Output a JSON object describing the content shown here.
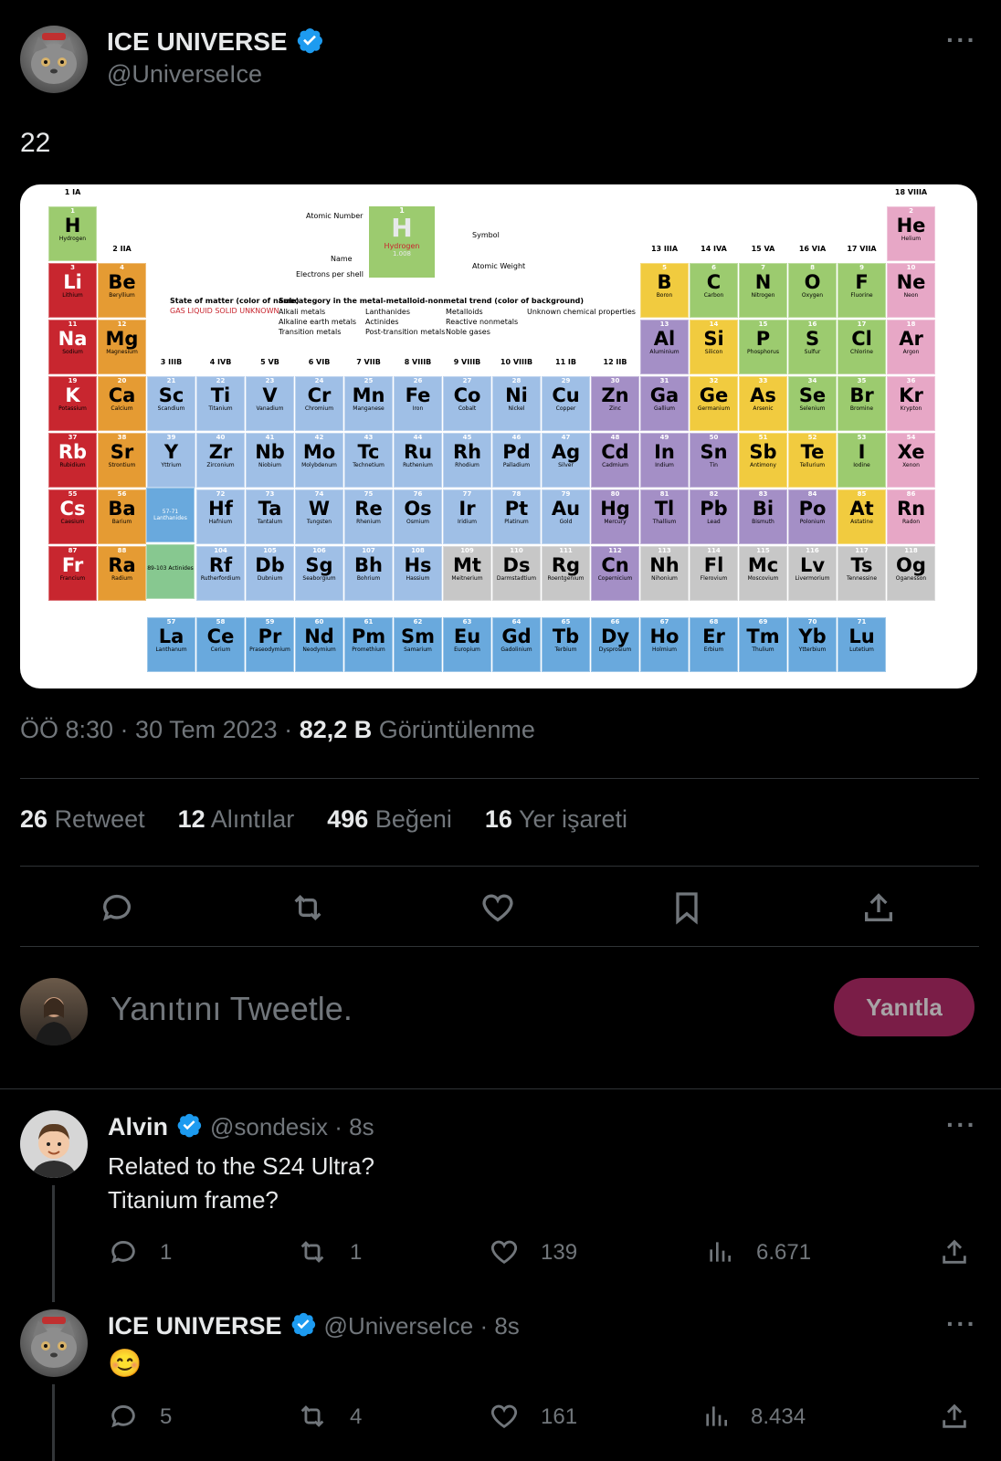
{
  "tweet": {
    "author_name": "ICE UNIVERSE",
    "author_handle": "@UniverseIce",
    "text": "22",
    "timestamp": "ÖÖ 8:30 · 30 Tem 2023 ·",
    "views_count": "82,2 B",
    "views_label": "Görüntülenme",
    "stats": [
      {
        "count": "26",
        "label": "Retweet"
      },
      {
        "count": "12",
        "label": "Alıntılar"
      },
      {
        "count": "496",
        "label": "Beğeni"
      },
      {
        "count": "16",
        "label": "Yer işareti"
      }
    ]
  },
  "image": {
    "legend_atomic_number": "Atomic Number",
    "legend_symbol": "Symbol",
    "legend_name": "Name",
    "legend_weight": "Atomic Weight",
    "legend_shells": "Electrons per shell",
    "legend_state": "State of matter (color of name)",
    "legend_state_values": "GAS  LIQUID  SOLID  UNKNOWN",
    "legend_subcat": "Subcategory in the metal-metalloid-nonmetal trend (color of background)",
    "legend_items": [
      "Alkali metals",
      "Alkaline earth metals",
      "Transition metals",
      "Lanthanides",
      "Actinides",
      "Post-transition metals",
      "Metalloids",
      "Reactive nonmetals",
      "Noble gases",
      "Unknown chemical properties"
    ],
    "key_number": "1",
    "key_symbol": "H",
    "key_name": "Hydrogen",
    "key_weight": "1.008",
    "lanthanides_label": "57-71 Lanthanides",
    "actinides_label": "89-103 Actinides",
    "groups": [
      "1 IA",
      "2 IIA",
      "3 IIIB",
      "4 IVB",
      "5 VB",
      "6 VIB",
      "7 VIIB",
      "8 VIIIB",
      "9 VIIIB",
      "10 VIIIB",
      "11 IB",
      "12 IIB",
      "13 IIIA",
      "14 IVA",
      "15 VA",
      "16 VIA",
      "17 VIIA",
      "18 VIIIA"
    ],
    "colors": {
      "alkali": "#c8262f",
      "alkaline": "#e59b33",
      "transition": "#9fbfe6",
      "post": "#a48fc6",
      "metalloid": "#f1cb3f",
      "nonmetal": "#9ccb6f",
      "noble": "#e7a7c6",
      "unknown": "#c7c7c7",
      "lanth": "#69a9dd",
      "actin": "#87c890"
    },
    "elements": [
      {
        "num": "1",
        "sym": "H",
        "name": "Hydrogen",
        "cat": "nonmetal"
      },
      {
        "num": "2",
        "sym": "He",
        "name": "Helium",
        "cat": "noble"
      },
      {
        "num": "3",
        "sym": "Li",
        "name": "Lithium",
        "cat": "alkali"
      },
      {
        "num": "4",
        "sym": "Be",
        "name": "Beryllium",
        "cat": "alkaline"
      },
      {
        "num": "5",
        "sym": "B",
        "name": "Boron",
        "cat": "metalloid"
      },
      {
        "num": "6",
        "sym": "C",
        "name": "Carbon",
        "cat": "nonmetal"
      },
      {
        "num": "7",
        "sym": "N",
        "name": "Nitrogen",
        "cat": "nonmetal"
      },
      {
        "num": "8",
        "sym": "O",
        "name": "Oxygen",
        "cat": "nonmetal"
      },
      {
        "num": "9",
        "sym": "F",
        "name": "Fluorine",
        "cat": "nonmetal"
      },
      {
        "num": "10",
        "sym": "Ne",
        "name": "Neon",
        "cat": "noble"
      },
      {
        "num": "11",
        "sym": "Na",
        "name": "Sodium",
        "cat": "alkali"
      },
      {
        "num": "12",
        "sym": "Mg",
        "name": "Magnesium",
        "cat": "alkaline"
      },
      {
        "num": "13",
        "sym": "Al",
        "name": "Aluminium",
        "cat": "post"
      },
      {
        "num": "14",
        "sym": "Si",
        "name": "Silicon",
        "cat": "metalloid"
      },
      {
        "num": "15",
        "sym": "P",
        "name": "Phosphorus",
        "cat": "nonmetal"
      },
      {
        "num": "16",
        "sym": "S",
        "name": "Sulfur",
        "cat": "nonmetal"
      },
      {
        "num": "17",
        "sym": "Cl",
        "name": "Chlorine",
        "cat": "nonmetal"
      },
      {
        "num": "18",
        "sym": "Ar",
        "name": "Argon",
        "cat": "noble"
      },
      {
        "num": "19",
        "sym": "K",
        "name": "Potassium",
        "cat": "alkali"
      },
      {
        "num": "20",
        "sym": "Ca",
        "name": "Calcium",
        "cat": "alkaline"
      },
      {
        "num": "21",
        "sym": "Sc",
        "name": "Scandium",
        "cat": "transition"
      },
      {
        "num": "22",
        "sym": "Ti",
        "name": "Titanium",
        "cat": "transition"
      },
      {
        "num": "23",
        "sym": "V",
        "name": "Vanadium",
        "cat": "transition"
      },
      {
        "num": "24",
        "sym": "Cr",
        "name": "Chromium",
        "cat": "transition"
      },
      {
        "num": "25",
        "sym": "Mn",
        "name": "Manganese",
        "cat": "transition"
      },
      {
        "num": "26",
        "sym": "Fe",
        "name": "Iron",
        "cat": "transition"
      },
      {
        "num": "27",
        "sym": "Co",
        "name": "Cobalt",
        "cat": "transition"
      },
      {
        "num": "28",
        "sym": "Ni",
        "name": "Nickel",
        "cat": "transition"
      },
      {
        "num": "29",
        "sym": "Cu",
        "name": "Copper",
        "cat": "transition"
      },
      {
        "num": "30",
        "sym": "Zn",
        "name": "Zinc",
        "cat": "post"
      },
      {
        "num": "31",
        "sym": "Ga",
        "name": "Gallium",
        "cat": "post"
      },
      {
        "num": "32",
        "sym": "Ge",
        "name": "Germanium",
        "cat": "metalloid"
      },
      {
        "num": "33",
        "sym": "As",
        "name": "Arsenic",
        "cat": "metalloid"
      },
      {
        "num": "34",
        "sym": "Se",
        "name": "Selenium",
        "cat": "nonmetal"
      },
      {
        "num": "35",
        "sym": "Br",
        "name": "Bromine",
        "cat": "nonmetal"
      },
      {
        "num": "36",
        "sym": "Kr",
        "name": "Krypton",
        "cat": "noble"
      },
      {
        "num": "37",
        "sym": "Rb",
        "name": "Rubidium",
        "cat": "alkali"
      },
      {
        "num": "38",
        "sym": "Sr",
        "name": "Strontium",
        "cat": "alkaline"
      },
      {
        "num": "39",
        "sym": "Y",
        "name": "Yttrium",
        "cat": "transition"
      },
      {
        "num": "40",
        "sym": "Zr",
        "name": "Zirconium",
        "cat": "transition"
      },
      {
        "num": "41",
        "sym": "Nb",
        "name": "Niobium",
        "cat": "transition"
      },
      {
        "num": "42",
        "sym": "Mo",
        "name": "Molybdenum",
        "cat": "transition"
      },
      {
        "num": "43",
        "sym": "Tc",
        "name": "Technetium",
        "cat": "transition"
      },
      {
        "num": "44",
        "sym": "Ru",
        "name": "Ruthenium",
        "cat": "transition"
      },
      {
        "num": "45",
        "sym": "Rh",
        "name": "Rhodium",
        "cat": "transition"
      },
      {
        "num": "46",
        "sym": "Pd",
        "name": "Palladium",
        "cat": "transition"
      },
      {
        "num": "47",
        "sym": "Ag",
        "name": "Silver",
        "cat": "transition"
      },
      {
        "num": "48",
        "sym": "Cd",
        "name": "Cadmium",
        "cat": "post"
      },
      {
        "num": "49",
        "sym": "In",
        "name": "Indium",
        "cat": "post"
      },
      {
        "num": "50",
        "sym": "Sn",
        "name": "Tin",
        "cat": "post"
      },
      {
        "num": "51",
        "sym": "Sb",
        "name": "Antimony",
        "cat": "metalloid"
      },
      {
        "num": "52",
        "sym": "Te",
        "name": "Tellurium",
        "cat": "metalloid"
      },
      {
        "num": "53",
        "sym": "I",
        "name": "Iodine",
        "cat": "nonmetal"
      },
      {
        "num": "54",
        "sym": "Xe",
        "name": "Xenon",
        "cat": "noble"
      },
      {
        "num": "55",
        "sym": "Cs",
        "name": "Caesium",
        "cat": "alkali"
      },
      {
        "num": "56",
        "sym": "Ba",
        "name": "Barium",
        "cat": "alkaline"
      },
      {
        "num": "72",
        "sym": "Hf",
        "name": "Hafnium",
        "cat": "transition"
      },
      {
        "num": "73",
        "sym": "Ta",
        "name": "Tantalum",
        "cat": "transition"
      },
      {
        "num": "74",
        "sym": "W",
        "name": "Tungsten",
        "cat": "transition"
      },
      {
        "num": "75",
        "sym": "Re",
        "name": "Rhenium",
        "cat": "transition"
      },
      {
        "num": "76",
        "sym": "Os",
        "name": "Osmium",
        "cat": "transition"
      },
      {
        "num": "77",
        "sym": "Ir",
        "name": "Iridium",
        "cat": "transition"
      },
      {
        "num": "78",
        "sym": "Pt",
        "name": "Platinum",
        "cat": "transition"
      },
      {
        "num": "79",
        "sym": "Au",
        "name": "Gold",
        "cat": "transition"
      },
      {
        "num": "80",
        "sym": "Hg",
        "name": "Mercury",
        "cat": "post"
      },
      {
        "num": "81",
        "sym": "Tl",
        "name": "Thallium",
        "cat": "post"
      },
      {
        "num": "82",
        "sym": "Pb",
        "name": "Lead",
        "cat": "post"
      },
      {
        "num": "83",
        "sym": "Bi",
        "name": "Bismuth",
        "cat": "post"
      },
      {
        "num": "84",
        "sym": "Po",
        "name": "Polonium",
        "cat": "post"
      },
      {
        "num": "85",
        "sym": "At",
        "name": "Astatine",
        "cat": "metalloid"
      },
      {
        "num": "86",
        "sym": "Rn",
        "name": "Radon",
        "cat": "noble"
      },
      {
        "num": "87",
        "sym": "Fr",
        "name": "Francium",
        "cat": "alkali"
      },
      {
        "num": "88",
        "sym": "Ra",
        "name": "Radium",
        "cat": "alkaline"
      },
      {
        "num": "104",
        "sym": "Rf",
        "name": "Rutherfordium",
        "cat": "transition"
      },
      {
        "num": "105",
        "sym": "Db",
        "name": "Dubnium",
        "cat": "transition"
      },
      {
        "num": "106",
        "sym": "Sg",
        "name": "Seaborgium",
        "cat": "transition"
      },
      {
        "num": "107",
        "sym": "Bh",
        "name": "Bohrium",
        "cat": "transition"
      },
      {
        "num": "108",
        "sym": "Hs",
        "name": "Hassium",
        "cat": "transition"
      },
      {
        "num": "109",
        "sym": "Mt",
        "name": "Meitnerium",
        "cat": "unknown"
      },
      {
        "num": "110",
        "sym": "Ds",
        "name": "Darmstadtium",
        "cat": "unknown"
      },
      {
        "num": "111",
        "sym": "Rg",
        "name": "Roentgenium",
        "cat": "unknown"
      },
      {
        "num": "112",
        "sym": "Cn",
        "name": "Copernicium",
        "cat": "post"
      },
      {
        "num": "113",
        "sym": "Nh",
        "name": "Nihonium",
        "cat": "unknown"
      },
      {
        "num": "114",
        "sym": "Fl",
        "name": "Flerovium",
        "cat": "unknown"
      },
      {
        "num": "115",
        "sym": "Mc",
        "name": "Moscovium",
        "cat": "unknown"
      },
      {
        "num": "116",
        "sym": "Lv",
        "name": "Livermorium",
        "cat": "unknown"
      },
      {
        "num": "117",
        "sym": "Ts",
        "name": "Tennessine",
        "cat": "unknown"
      },
      {
        "num": "118",
        "sym": "Og",
        "name": "Oganesson",
        "cat": "unknown"
      },
      {
        "num": "57",
        "sym": "La",
        "name": "Lanthanum",
        "cat": "lanth"
      },
      {
        "num": "58",
        "sym": "Ce",
        "name": "Cerium",
        "cat": "lanth"
      },
      {
        "num": "59",
        "sym": "Pr",
        "name": "Praseodymium",
        "cat": "lanth"
      },
      {
        "num": "60",
        "sym": "Nd",
        "name": "Neodymium",
        "cat": "lanth"
      },
      {
        "num": "61",
        "sym": "Pm",
        "name": "Promethium",
        "cat": "lanth"
      },
      {
        "num": "62",
        "sym": "Sm",
        "name": "Samarium",
        "cat": "lanth"
      },
      {
        "num": "63",
        "sym": "Eu",
        "name": "Europium",
        "cat": "lanth"
      },
      {
        "num": "64",
        "sym": "Gd",
        "name": "Gadolinium",
        "cat": "lanth"
      },
      {
        "num": "65",
        "sym": "Tb",
        "name": "Terbium",
        "cat": "lanth"
      },
      {
        "num": "66",
        "sym": "Dy",
        "name": "Dysprosium",
        "cat": "lanth"
      },
      {
        "num": "67",
        "sym": "Ho",
        "name": "Holmium",
        "cat": "lanth"
      },
      {
        "num": "68",
        "sym": "Er",
        "name": "Erbium",
        "cat": "lanth"
      },
      {
        "num": "69",
        "sym": "Tm",
        "name": "Thulium",
        "cat": "lanth"
      },
      {
        "num": "70",
        "sym": "Yb",
        "name": "Ytterbium",
        "cat": "lanth"
      },
      {
        "num": "71",
        "sym": "Lu",
        "name": "Lutetium",
        "cat": "lanth"
      }
    ]
  },
  "compose": {
    "placeholder": "Yanıtını Tweetle.",
    "button_label": "Yanıtla"
  },
  "replies": [
    {
      "author_name": "Alvin",
      "author_handle": "@sondesix · 8s",
      "lines": [
        "Related to the S24 Ultra?",
        "Titanium frame?"
      ],
      "replies": "1",
      "retweets": "1",
      "likes": "139",
      "views": "6.671"
    },
    {
      "author_name": "ICE UNIVERSE",
      "author_handle": "@UniverseIce · 8s",
      "emoji": "😊",
      "replies": "5",
      "retweets": "4",
      "likes": "161",
      "views": "8.434"
    }
  ],
  "icons": [
    "verified-badge-icon",
    "more-icon",
    "reply-icon",
    "retweet-icon",
    "like-icon",
    "bookmark-icon",
    "share-icon",
    "views-icon"
  ],
  "theme": {
    "background": "#000000",
    "text": "#e7e9ea",
    "muted": "#71767b",
    "verified": "#1d9bf0",
    "reply_button": "#7a1d47"
  }
}
